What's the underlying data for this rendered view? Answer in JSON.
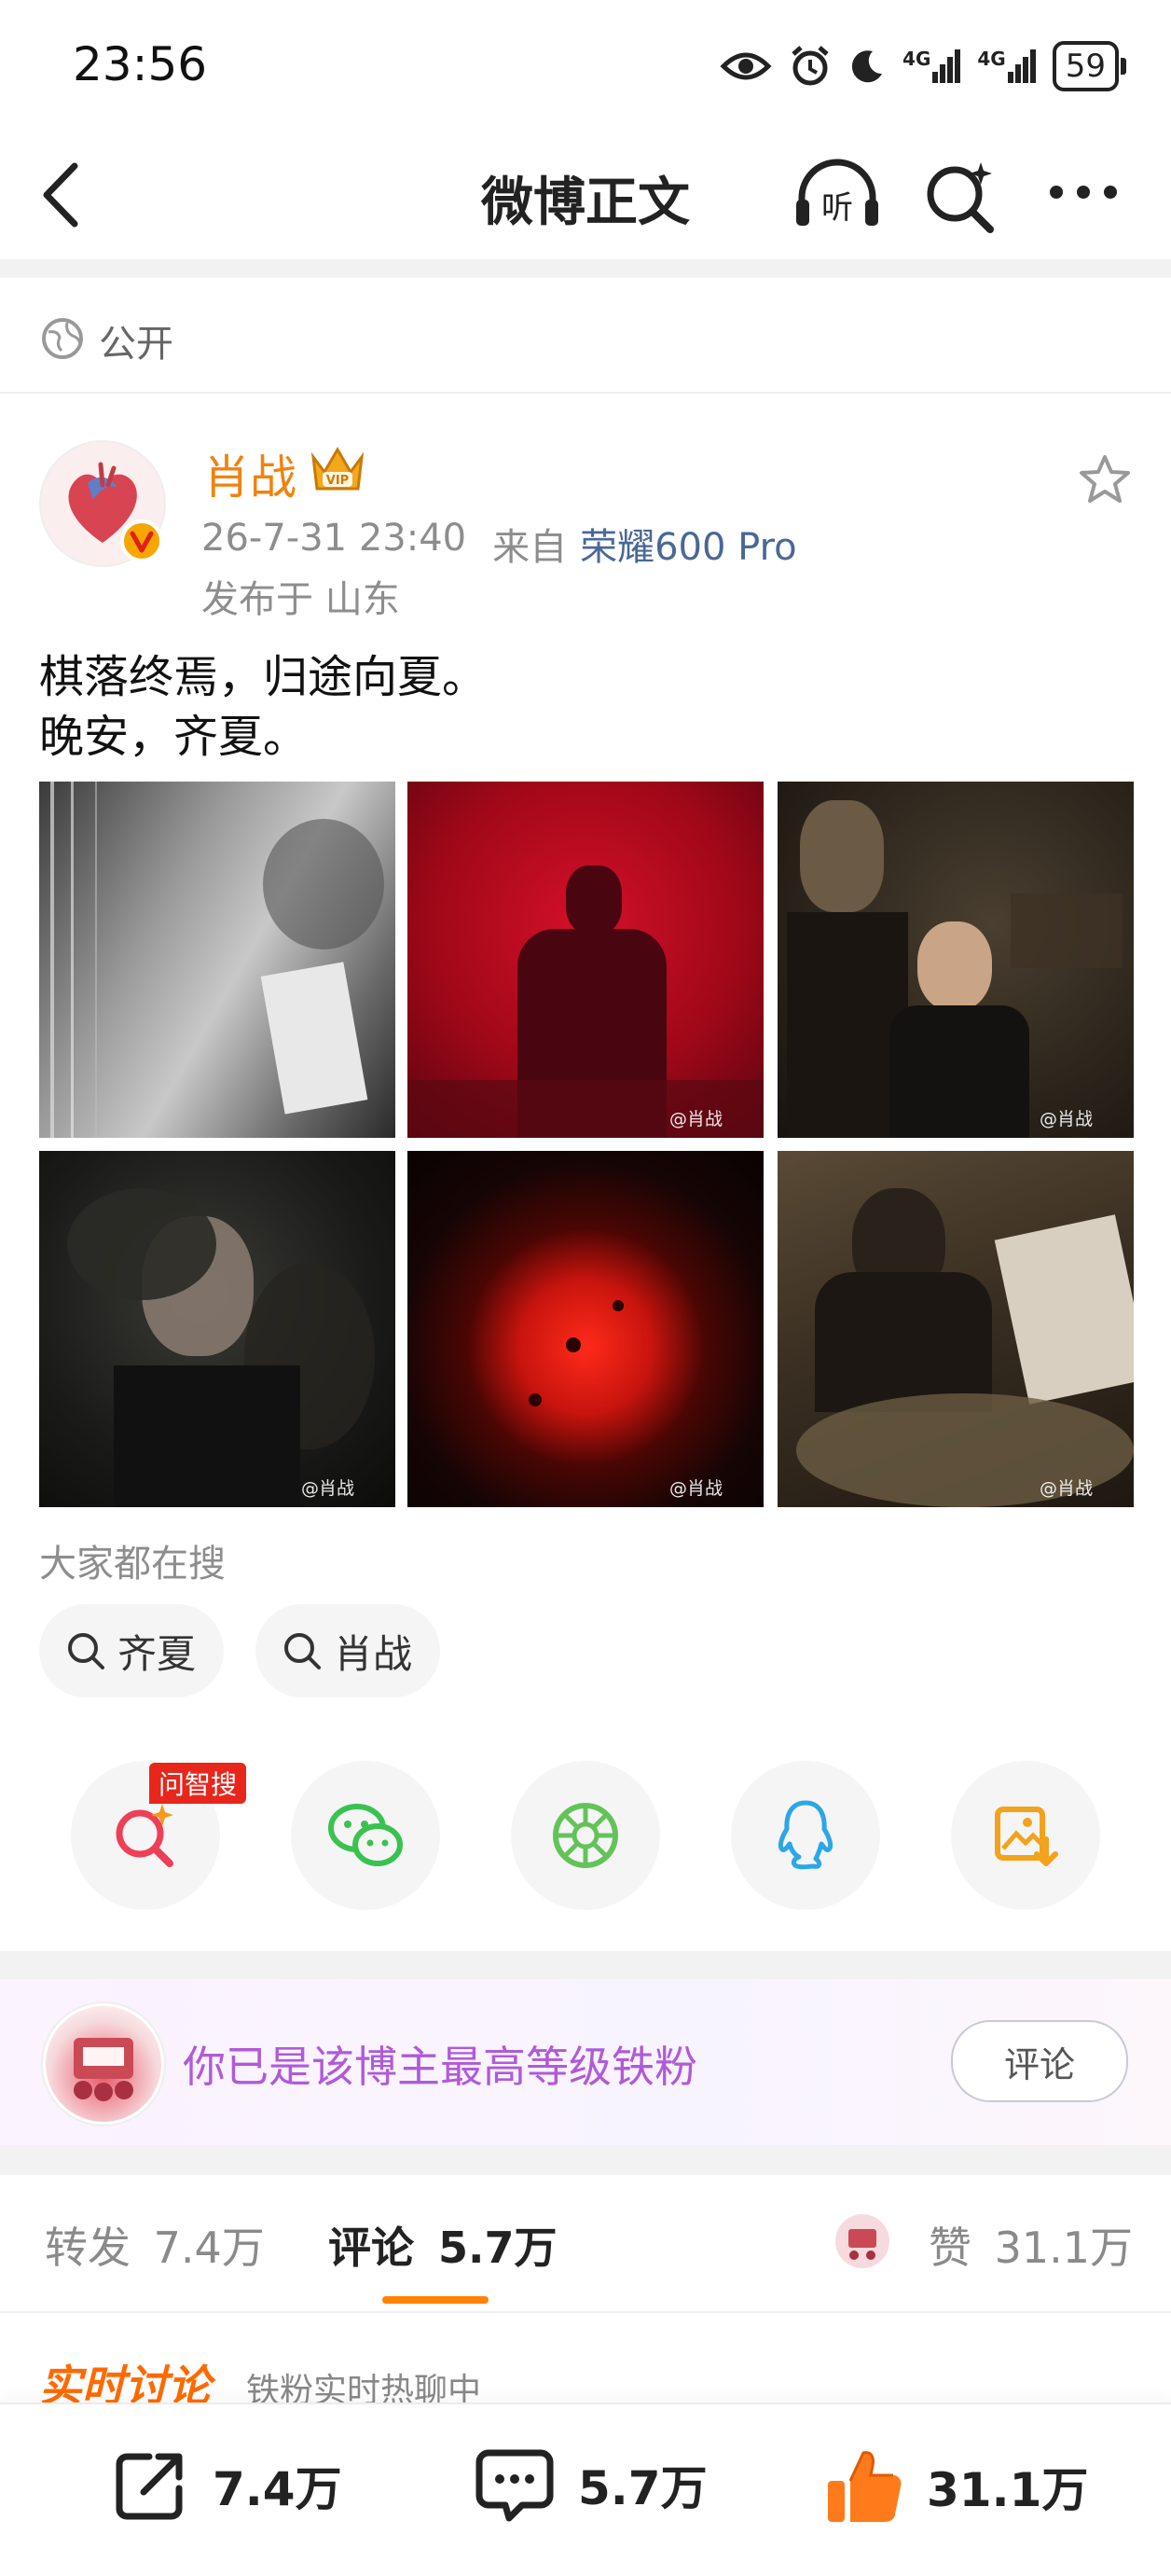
{
  "status_bar": {
    "time": "23:56",
    "battery": "59",
    "net1": "4G",
    "net2": "4G"
  },
  "nav": {
    "title": "微博正文"
  },
  "visibility": {
    "label": "公开"
  },
  "post": {
    "author": "肖战",
    "timestamp": "26-7-31 23:40",
    "source_prefix": "来自",
    "device": "荣耀600 Pro",
    "location": "发布于 山东",
    "text_line1": "棋落终焉，归途向夏。",
    "text_line2": "晚安，齐夏。",
    "watermark": "@肖战"
  },
  "hot_search": {
    "label": "大家都在搜",
    "chips": [
      "齐夏",
      "肖战"
    ]
  },
  "share": {
    "badge": "问智搜"
  },
  "fan_banner": {
    "text": "你已是该博主最高等级铁粉",
    "button": "评论"
  },
  "tabs": {
    "repost_label": "转发",
    "repost_count": "7.4万",
    "comment_label": "评论",
    "comment_count": "5.7万",
    "like_label": "赞",
    "like_count": "31.1万"
  },
  "discussion": {
    "title": "实时讨论",
    "subtitle": "铁粉实时热聊中"
  },
  "bottom_bar": {
    "repost": "7.4万",
    "comment": "5.7万",
    "like": "31.1万"
  },
  "colors": {
    "accent_orange": "#f0820f",
    "link_blue": "#4a6896",
    "fan_purple": "#b05ad8",
    "tab_underline": "#ff8200"
  }
}
